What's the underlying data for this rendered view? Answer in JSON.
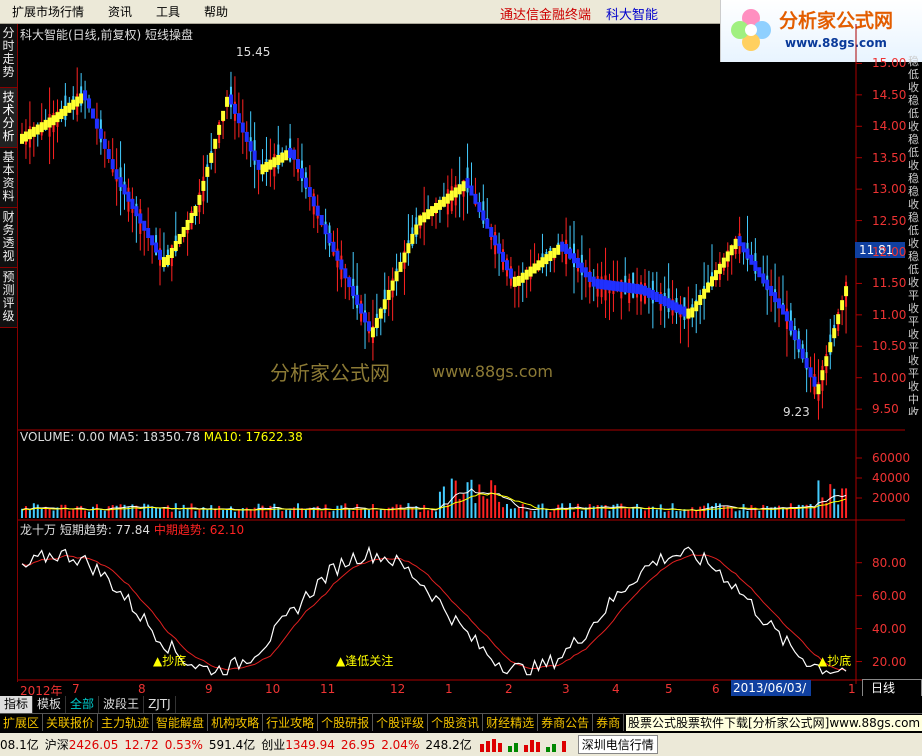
{
  "menu": {
    "items": [
      "扩展市场行情",
      "资讯",
      "工具",
      "帮助"
    ],
    "brand_red": "通达信金融终端",
    "brand_blue": "科大智能"
  },
  "logo": {
    "title": "分析家公式网",
    "url": "www.88gs.com"
  },
  "sidebar": {
    "tabs": [
      "分时走势",
      "技术分析",
      "基本资料",
      "财务透视",
      "预测评级"
    ],
    "active": 1
  },
  "chart": {
    "title": "科大智能(日线,前复权) 短线操盘",
    "high_label": "15.45",
    "low_label": "9.23",
    "current_price": "11.81",
    "watermark_cn": "分析家公式网",
    "watermark_url": "www.88gs.com",
    "right_strip": "稳低收稳低收稳低收稳稳收稳低收稳低收平收平收平收平收中收稳低收",
    "y_ticks": [
      "15.00",
      "14.50",
      "14.00",
      "13.50",
      "13.00",
      "12.50",
      "12.00",
      "11.50",
      "11.00",
      "10.50",
      "10.00",
      "9.50"
    ],
    "y_range": [
      9.2,
      15.5
    ],
    "colors": {
      "up": "#f22",
      "down": "#4cf",
      "trend_up": "#ffff30",
      "trend_down": "#2030ff"
    },
    "trend_path": [
      [
        0,
        13.8
      ],
      [
        4,
        14.1
      ],
      [
        8,
        14.5
      ],
      [
        12,
        13.2
      ],
      [
        18,
        11.8
      ],
      [
        22,
        12.7
      ],
      [
        26,
        14.5
      ],
      [
        30,
        13.3
      ],
      [
        34,
        13.6
      ],
      [
        38,
        12.4
      ],
      [
        44,
        10.7
      ],
      [
        50,
        12.5
      ],
      [
        56,
        13.1
      ],
      [
        62,
        11.5
      ],
      [
        68,
        12.1
      ],
      [
        72,
        11.5
      ],
      [
        78,
        11.4
      ],
      [
        84,
        11.0
      ],
      [
        90,
        12.2
      ],
      [
        96,
        11.0
      ],
      [
        100,
        9.8
      ],
      [
        104,
        11.6
      ]
    ]
  },
  "volume": {
    "label": "VOLUME: 0.00",
    "ma5_label": "MA5: 18350.78",
    "ma10_label": "MA10: 17622.38",
    "y_ticks": [
      "60000",
      "40000",
      "20000"
    ],
    "colors": {
      "ma5": "#fff",
      "ma10": "#ffff00"
    }
  },
  "indicator": {
    "name": "龙十万",
    "short_label": "短期趋势: 77.84",
    "mid_label": "中期趋势: 62.10",
    "y_ticks": [
      "80.00",
      "60.00",
      "40.00",
      "20.00"
    ],
    "signals": [
      "抄底",
      "逢低关注",
      "抄底"
    ],
    "colors": {
      "short": "#fff",
      "mid": "#e02020",
      "signal": "#ffff00"
    }
  },
  "xaxis": {
    "labels": [
      "2012年",
      "7",
      "8",
      "9",
      "10",
      "11",
      "12",
      "1",
      "2",
      "3",
      "4",
      "5",
      "6",
      "1"
    ],
    "date_box": "2013/06/03/一",
    "period": "日线"
  },
  "tabs": [
    "指标",
    "模板",
    "全部",
    "波段王",
    "ZJTJ"
  ],
  "funcs": [
    "扩展区",
    "关联报价",
    "主力轨迹",
    "智能解盘",
    "机构攻略",
    "行业攻略",
    "个股研报",
    "个股评级",
    "个股资讯",
    "财经精选",
    "券商公告",
    "券商"
  ],
  "ad_text": "股票公式股票软件下载[分析家公式网]www.88gs.com",
  "status": {
    "idx1_name": "沪深",
    "idx1_val": "2426.05",
    "idx1_chg": "12.72",
    "idx1_pct": "0.53%",
    "idx1_amt": "591.4亿",
    "idx2_name": "创业",
    "idx2_val": "1349.94",
    "idx2_chg": "26.95",
    "idx2_pct": "2.04%",
    "idx2_amt": "248.2亿",
    "lead": "08.1亿",
    "news": "深圳电信行情"
  }
}
